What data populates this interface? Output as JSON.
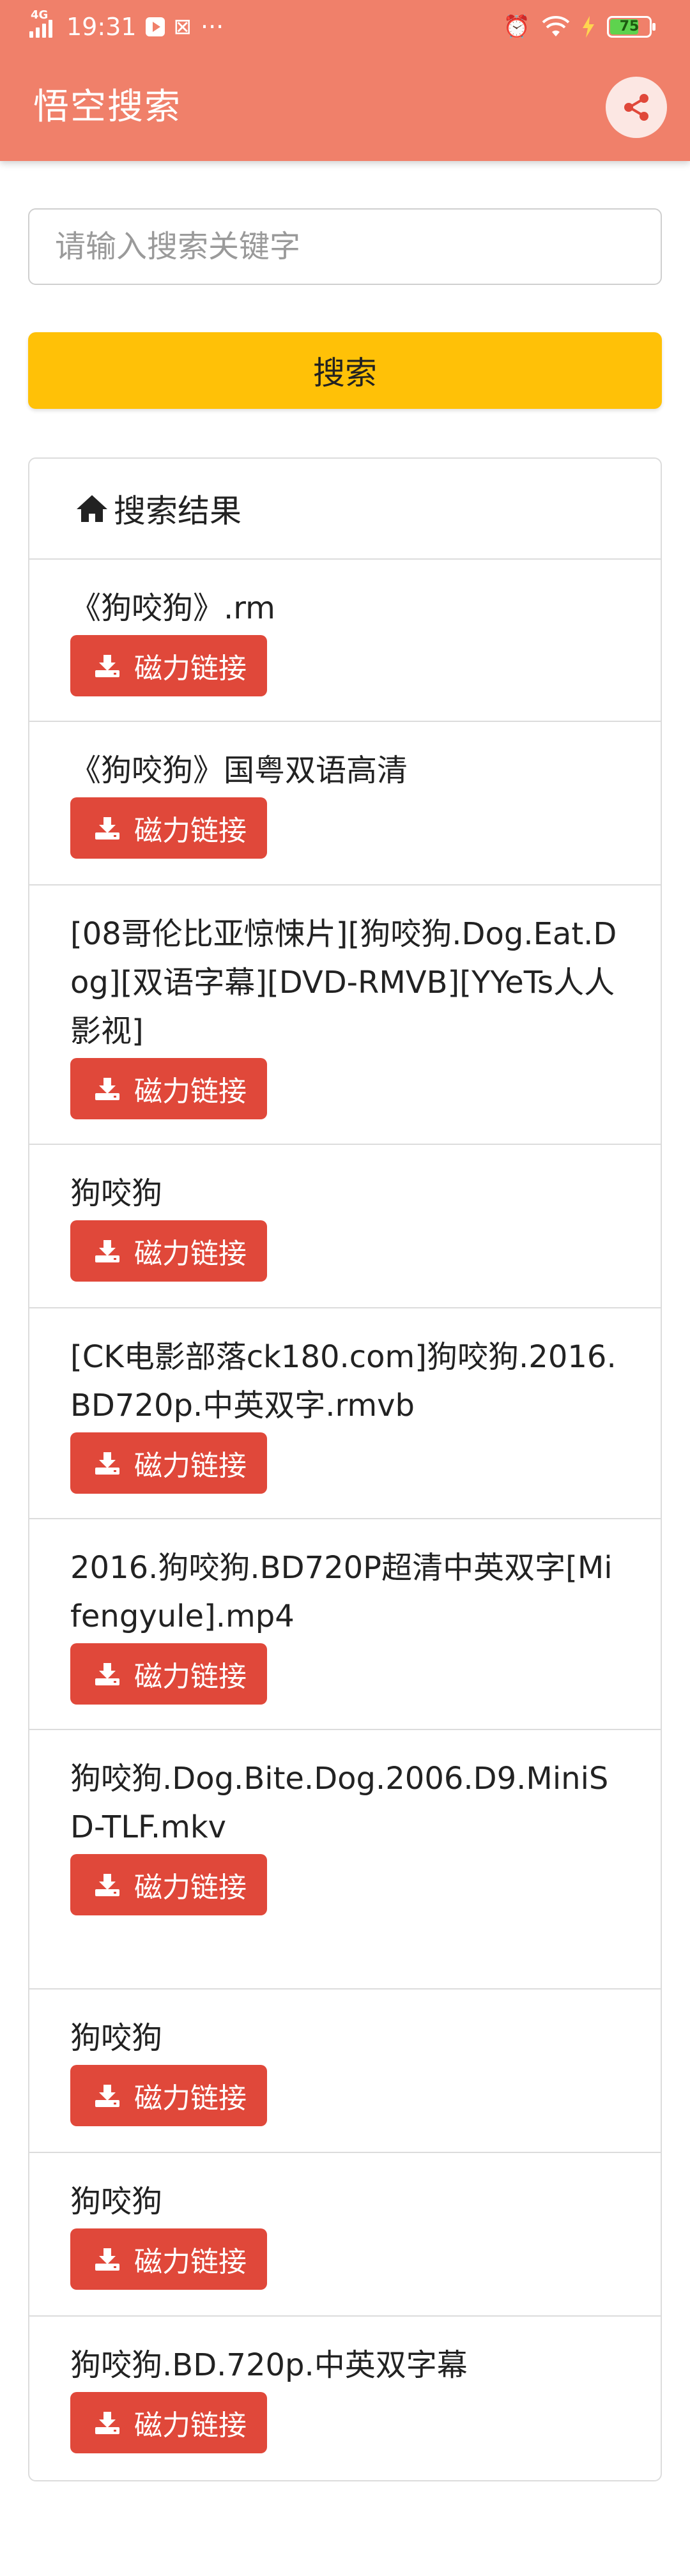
{
  "status_bar": {
    "network": "4G",
    "time": "19:31",
    "more": "···",
    "battery": "75"
  },
  "app_bar": {
    "title": "悟空搜索",
    "share_icon": "share-icon",
    "color": "#F0806A"
  },
  "search": {
    "placeholder": "请输入搜索关键字",
    "value": "",
    "button_label": "搜索",
    "button_color": "#FFC107"
  },
  "results": {
    "heading": "搜索结果",
    "heading_icon": "home-icon",
    "magnet_label": "磁力链接",
    "magnet_color": "#E0483A",
    "items": [
      {
        "title": "《狗咬狗》.rm"
      },
      {
        "title": "《狗咬狗》国粤双语高清"
      },
      {
        "title": "[08哥伦比亚惊悚片][狗咬狗.Dog.Eat.Dog][双语字幕][DVD-RMVB][YYeTs人人影视]"
      },
      {
        "title": "狗咬狗"
      },
      {
        "title": "[CK电影部落ck180.com]狗咬狗.2016.BD720p.中英双字.rmvb"
      },
      {
        "title": "2016.狗咬狗.BD720P超清中英双字[Mifengyule].mp4"
      },
      {
        "title": "狗咬狗.Dog.Bite.Dog.2006.D9.MiniSD-TLF.mkv"
      },
      {
        "title": "狗咬狗"
      },
      {
        "title": "狗咬狗"
      },
      {
        "title": "狗咬狗.BD.720p.中英双字幕"
      }
    ]
  }
}
